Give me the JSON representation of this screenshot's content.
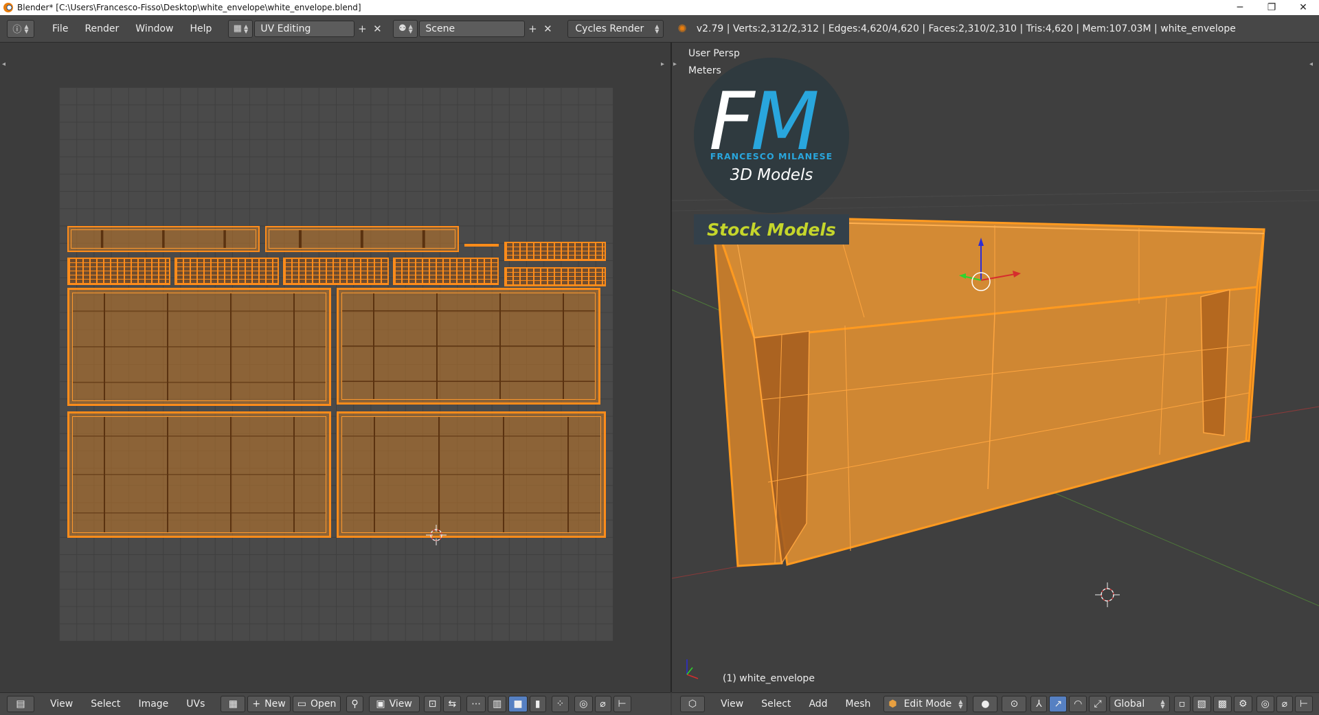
{
  "window": {
    "title": "Blender* [C:\\Users\\Francesco-Fisso\\Desktop\\white_envelope\\white_envelope.blend]",
    "minimize": "─",
    "restore": "❐",
    "close": "✕"
  },
  "info_header": {
    "menus": [
      "File",
      "Render",
      "Window",
      "Help"
    ],
    "screen_layout": "UV Editing",
    "scene": "Scene",
    "render_engine": "Cycles Render",
    "stats": "v2.79 | Verts:2,312/2,312 | Edges:4,620/4,620 | Faces:2,310/2,310 | Tris:4,620 | Mem:107.03M | white_envelope"
  },
  "view3d": {
    "view_name": "User Persp",
    "units": "Meters",
    "object_label": "(1) white_envelope",
    "logo": {
      "letters_f": "F",
      "letters_m": "M",
      "author": "FRANCESCO MILANESE",
      "subtitle": "3D Models",
      "badge": "Stock Models"
    }
  },
  "uv_footer": {
    "menus": [
      "View",
      "Select",
      "Image",
      "UVs"
    ],
    "new_label": "New",
    "open_label": "Open",
    "view_label": "View"
  },
  "view_footer": {
    "menus": [
      "View",
      "Select",
      "Add",
      "Mesh"
    ],
    "mode": "Edit Mode",
    "orientation": "Global"
  },
  "colors": {
    "selection": "#ff8c1a",
    "header_bg": "#474747",
    "viewport_bg": "#3f3f3f",
    "logo_blue": "#29a6dd",
    "badge_yellow": "#c5d62b"
  }
}
